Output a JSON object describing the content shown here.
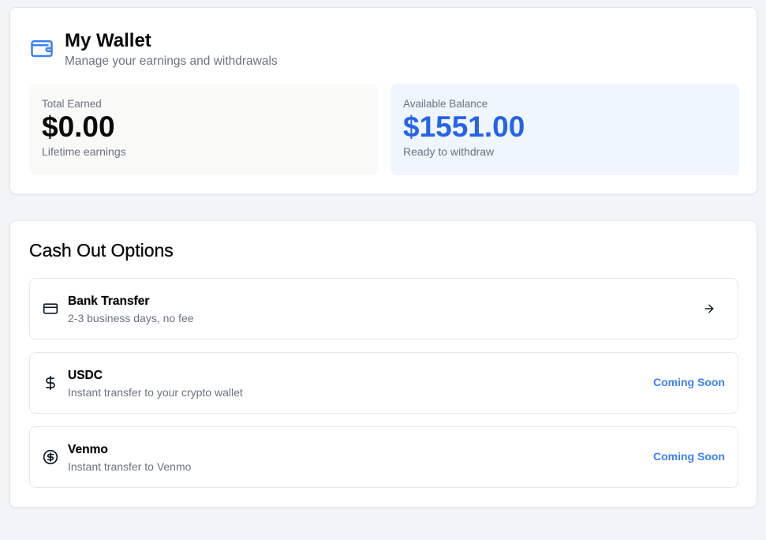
{
  "wallet": {
    "title": "My Wallet",
    "subtitle": "Manage your earnings and withdrawals",
    "icon": "wallet-icon",
    "accent_color": "#3b82f6"
  },
  "stats": {
    "total_earned": {
      "label": "Total Earned",
      "value": "$0.00",
      "note": "Lifetime earnings"
    },
    "available_balance": {
      "label": "Available Balance",
      "value": "$1551.00",
      "note": "Ready to withdraw",
      "color": "#2563eb"
    }
  },
  "cashout": {
    "title": "Cash Out Options",
    "options": [
      {
        "name": "Bank Transfer",
        "description": "2-3 business days, no fee",
        "icon": "credit-card-icon",
        "action_icon": "arrow-right-icon"
      },
      {
        "name": "USDC",
        "description": "Instant transfer to your crypto wallet",
        "icon": "dollar-sign-icon",
        "badge": "Coming Soon"
      },
      {
        "name": "Venmo",
        "description": "Instant transfer to Venmo",
        "icon": "circle-dollar-icon",
        "badge": "Coming Soon"
      }
    ],
    "badge_color": "#3b82f6"
  }
}
